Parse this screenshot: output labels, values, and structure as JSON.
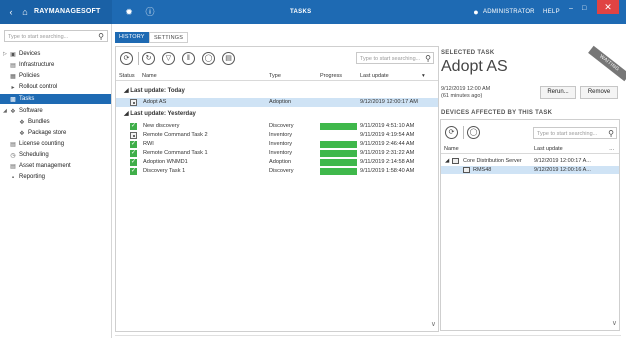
{
  "titlebar": {
    "brand": "RAYMANAGESOFT",
    "title": "TASKS",
    "user": "ADMINISTRATOR",
    "help": "HELP",
    "icons": [
      "back-icon",
      "home-icon",
      "settings-icon",
      "info-icon",
      "user-icon",
      "minimize-icon",
      "maximize-icon",
      "close-icon"
    ]
  },
  "nav": {
    "search_placeholder": "Type to start searching...",
    "items": [
      {
        "label": "Devices",
        "icon": "devices-icon"
      },
      {
        "label": "Infrastructure",
        "icon": "infrastructure-icon"
      },
      {
        "label": "Policies",
        "icon": "policies-icon"
      },
      {
        "label": "Rollout control",
        "icon": "rollout-icon"
      },
      {
        "label": "Tasks",
        "icon": "tasks-icon",
        "active": true
      },
      {
        "label": "Software",
        "icon": "software-icon"
      },
      {
        "label": "Bundles",
        "icon": "bundles-icon"
      },
      {
        "label": "Package store",
        "icon": "package-store-icon"
      },
      {
        "label": "License counting",
        "icon": "license-icon"
      },
      {
        "label": "Scheduling",
        "icon": "scheduling-icon"
      },
      {
        "label": "Asset management",
        "icon": "asset-icon"
      },
      {
        "label": "Reporting",
        "icon": "reporting-icon"
      }
    ]
  },
  "tabs": [
    {
      "label": "HISTORY",
      "active": true
    },
    {
      "label": "SETTINGS",
      "active": false
    }
  ],
  "tasks": {
    "search_placeholder": "Type to start searching...",
    "columns": {
      "status": "Status",
      "name": "Name",
      "type": "Type",
      "progress": "Progress",
      "last_update": "Last update"
    },
    "groups": [
      {
        "label": "Last update: Today",
        "rows": [
          {
            "name": "Adopt AS",
            "type": "Adoption",
            "progress": 0,
            "last_update": "9/12/2019 12:00:17 AM",
            "status": "pending",
            "selected": true
          }
        ]
      },
      {
        "label": "Last update: Yesterday",
        "rows": [
          {
            "name": "New discovery",
            "type": "Discovery",
            "progress": 100,
            "last_update": "9/11/2019 4:51:10 AM",
            "status": "done"
          },
          {
            "name": "Remote Command Task 2",
            "type": "Inventory",
            "progress": 0,
            "last_update": "9/11/2019 4:19:54 AM",
            "status": "pending"
          },
          {
            "name": "RWI",
            "type": "Inventory",
            "progress": 100,
            "last_update": "9/11/2019 2:46:44 AM",
            "status": "done"
          },
          {
            "name": "Remote Command Task 1",
            "type": "Inventory",
            "progress": 100,
            "last_update": "9/11/2019 2:31:22 AM",
            "status": "done"
          },
          {
            "name": "Adoption WNMD1",
            "type": "Adoption",
            "progress": 100,
            "last_update": "9/11/2019 2:14:58 AM",
            "status": "done"
          },
          {
            "name": "Discovery Task 1",
            "type": "Discovery",
            "progress": 100,
            "last_update": "9/11/2019 1:58:40 AM",
            "status": "done"
          }
        ]
      }
    ]
  },
  "selected_task": {
    "label": "SELECTED TASK",
    "title": "Adopt AS",
    "ribbon": "WAITING",
    "date": "9/12/2019 12:00 AM",
    "ago": "(61 minutes ago)",
    "rerun_label": "Rerun...",
    "remove_label": "Remove"
  },
  "devices": {
    "label": "DEVICES AFFECTED BY THIS TASK",
    "search_placeholder": "Type to start searching...",
    "columns": {
      "name": "Name",
      "last_update": "Last update"
    },
    "rows": [
      {
        "name": "Core Distribution Server",
        "last_update": "9/12/2019 12:00:17 A...",
        "selected": false
      },
      {
        "name": "RMS48",
        "last_update": "9/12/2019 12:00:16 A...",
        "selected": true
      }
    ]
  },
  "colors": {
    "accent": "#1e6ab3",
    "selection": "#cfe3f5",
    "progress": "#3fb84b",
    "close": "#e04343"
  }
}
